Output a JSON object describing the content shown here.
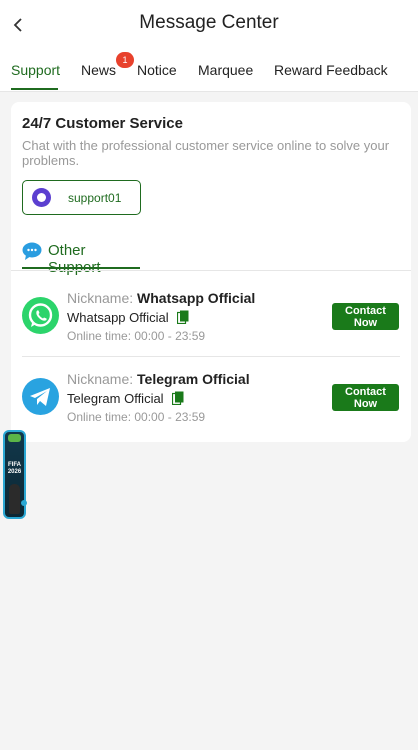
{
  "header": {
    "title": "Message Center",
    "back_icon": "chevron-left-icon"
  },
  "tabs": [
    {
      "label": "Support",
      "active": true
    },
    {
      "label": "News",
      "badge": "1"
    },
    {
      "label": "Notice"
    },
    {
      "label": "Marquee"
    },
    {
      "label": "Reward Feedback"
    }
  ],
  "customer_service": {
    "title": "24/7 Customer Service",
    "description": "Chat with the professional customer service online to solve your problems.",
    "support_label": "support01"
  },
  "other_support": {
    "label": "Other Support",
    "contacts": [
      {
        "icon": "whatsapp-icon",
        "nickname_prefix": "Nickname:",
        "nickname": "Whatsapp Official",
        "account": "Whatsapp Official",
        "online_time_label": "Online time:",
        "online_time": "00:00 - 23:59",
        "button": "Contact Now"
      },
      {
        "icon": "telegram-icon",
        "nickname_prefix": "Nickname:",
        "nickname": "Telegram Official",
        "account": "Telegram Official",
        "online_time_label": "Online time:",
        "online_time": "00:00 - 23:59",
        "button": "Contact Now"
      }
    ]
  },
  "float_banner": {
    "text": "FIFA 2026"
  },
  "colors": {
    "accent": "#1f6b1f",
    "button": "#1a7a1a",
    "badge": "#e8412c"
  }
}
